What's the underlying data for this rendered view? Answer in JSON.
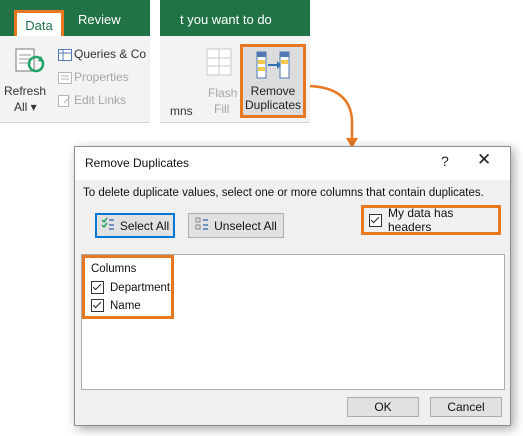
{
  "ribbon": {
    "tabs": {
      "data": "Data",
      "review": "Review",
      "tell_me": "t you want to do"
    },
    "refresh": {
      "line1": "Refresh",
      "line2": "All ▾"
    },
    "queries": "Queries & Co",
    "properties": "Properties",
    "edit_links": "Edit Links",
    "columns_partial": "mns",
    "flash_fill": {
      "line1": "Flash",
      "line2": "Fill"
    },
    "remove_duplicates": {
      "line1": "Remove",
      "line2": "Duplicates"
    }
  },
  "dialog": {
    "title": "Remove Duplicates",
    "help_glyph": "?",
    "close_glyph": "✕",
    "instruction": "To delete duplicate values, select one or more columns that contain duplicates.",
    "select_all": "Select All",
    "unselect_all": "Unselect All",
    "my_data_has_headers": "My data has headers",
    "columns_header": "Columns",
    "columns": [
      {
        "label": "Department",
        "checked": true
      },
      {
        "label": "Name",
        "checked": true
      }
    ],
    "ok": "OK",
    "cancel": "Cancel"
  },
  "colors": {
    "accent": "#e87722",
    "excel_green": "#217346",
    "focus_blue": "#0078d7"
  }
}
